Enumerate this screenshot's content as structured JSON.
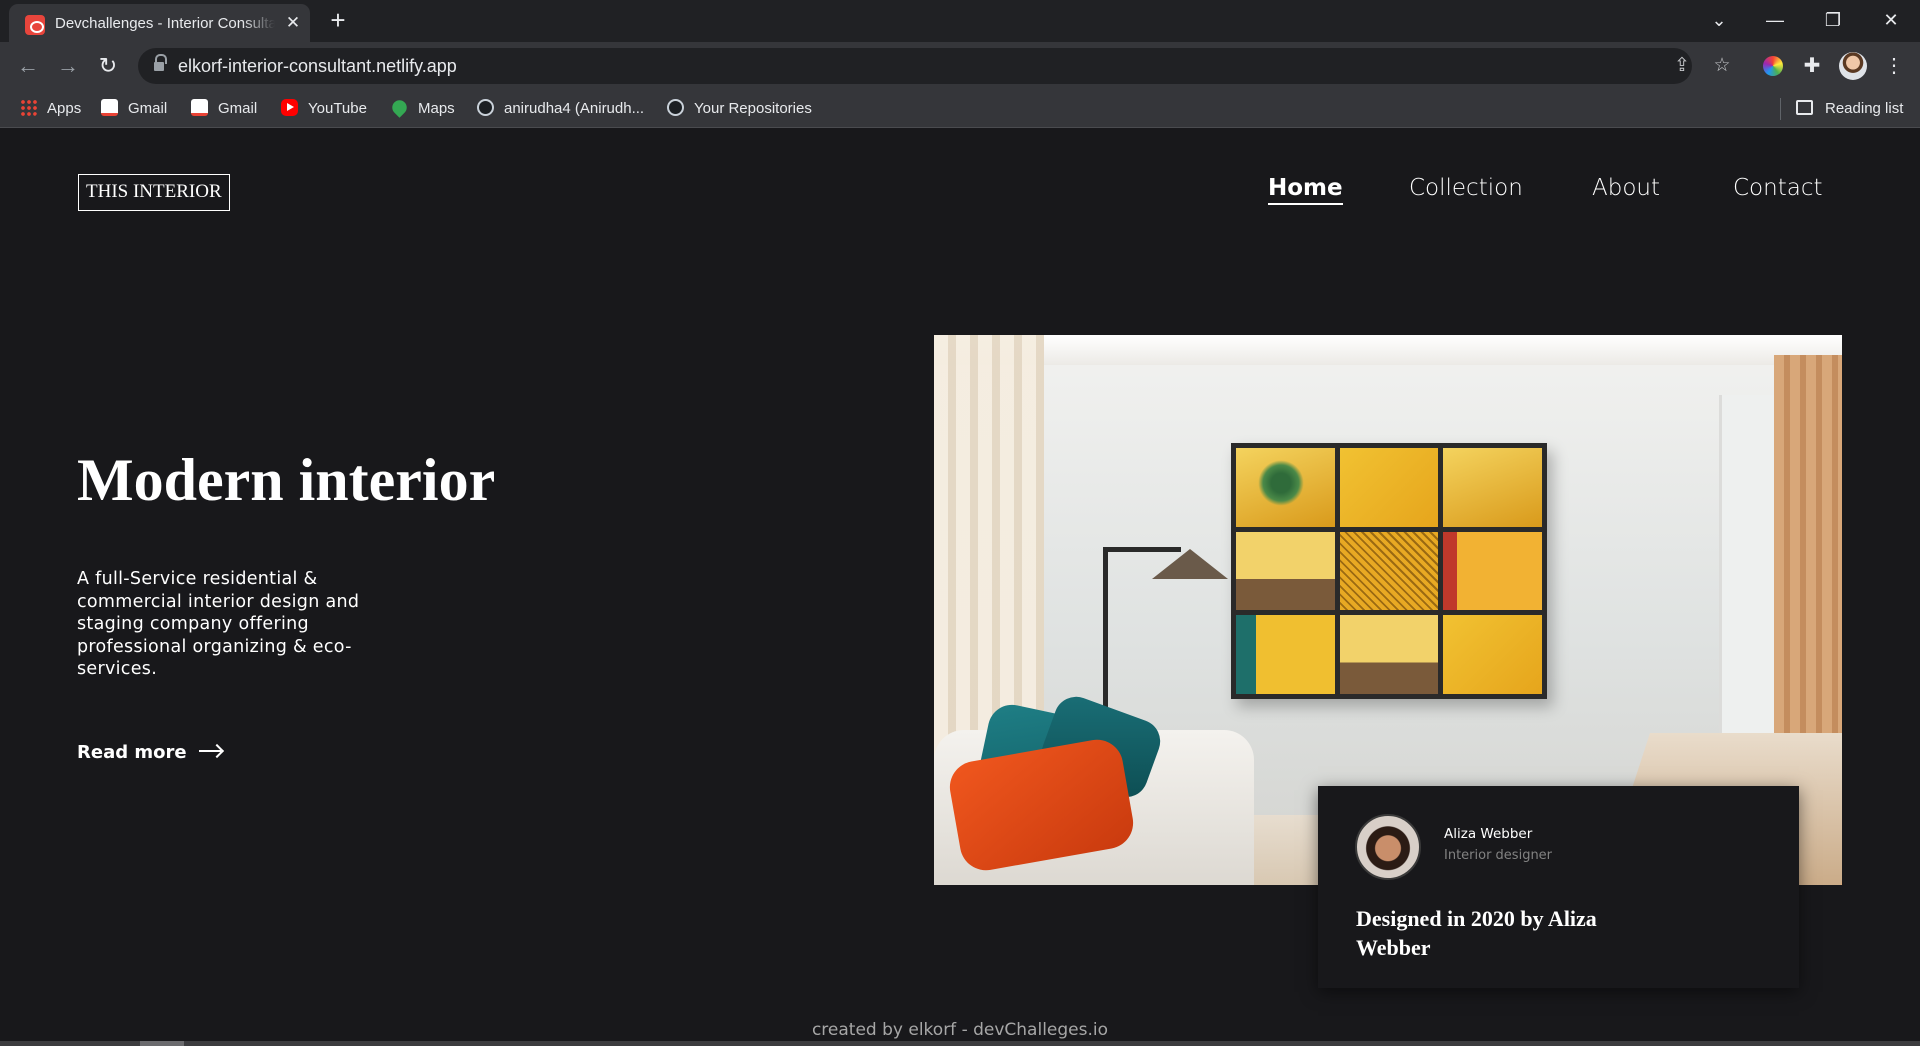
{
  "browser": {
    "tab_title": "Devchallenges - Interior Consultant",
    "url": "elkorf-interior-consultant.netlify.app",
    "bookmarks": [
      {
        "label": "Apps",
        "icon": "apps-grid-icon"
      },
      {
        "label": "Gmail",
        "icon": "gmail-icon"
      },
      {
        "label": "Gmail",
        "icon": "gmail-icon"
      },
      {
        "label": "YouTube",
        "icon": "youtube-icon"
      },
      {
        "label": "Maps",
        "icon": "maps-icon"
      },
      {
        "label": "anirudha4 (Anirudh...",
        "icon": "github-icon"
      },
      {
        "label": "Your Repositories",
        "icon": "github-icon"
      }
    ],
    "reading_list": "Reading list"
  },
  "site": {
    "logo": "THIS INTERIOR",
    "nav": [
      {
        "label": "Home",
        "active": true
      },
      {
        "label": "Collection",
        "active": false
      },
      {
        "label": "About",
        "active": false
      },
      {
        "label": "Contact",
        "active": false
      }
    ],
    "hero": {
      "title": "Modern interior",
      "description": "A full-Service residential & commercial interior design and staging company offering professional organizing & eco-services.",
      "read_more": "Read more"
    },
    "designer_card": {
      "name": "Aliza Webber",
      "role": "Interior designer",
      "text": "Designed in 2020 by Aliza Webber"
    },
    "footer": "created by elkorf - devChalleges.io"
  },
  "colors": {
    "page_bg": "#18181b",
    "text": "#ffffff",
    "muted": "#828282",
    "chrome_dark": "#202124",
    "chrome_light": "#35363a"
  }
}
